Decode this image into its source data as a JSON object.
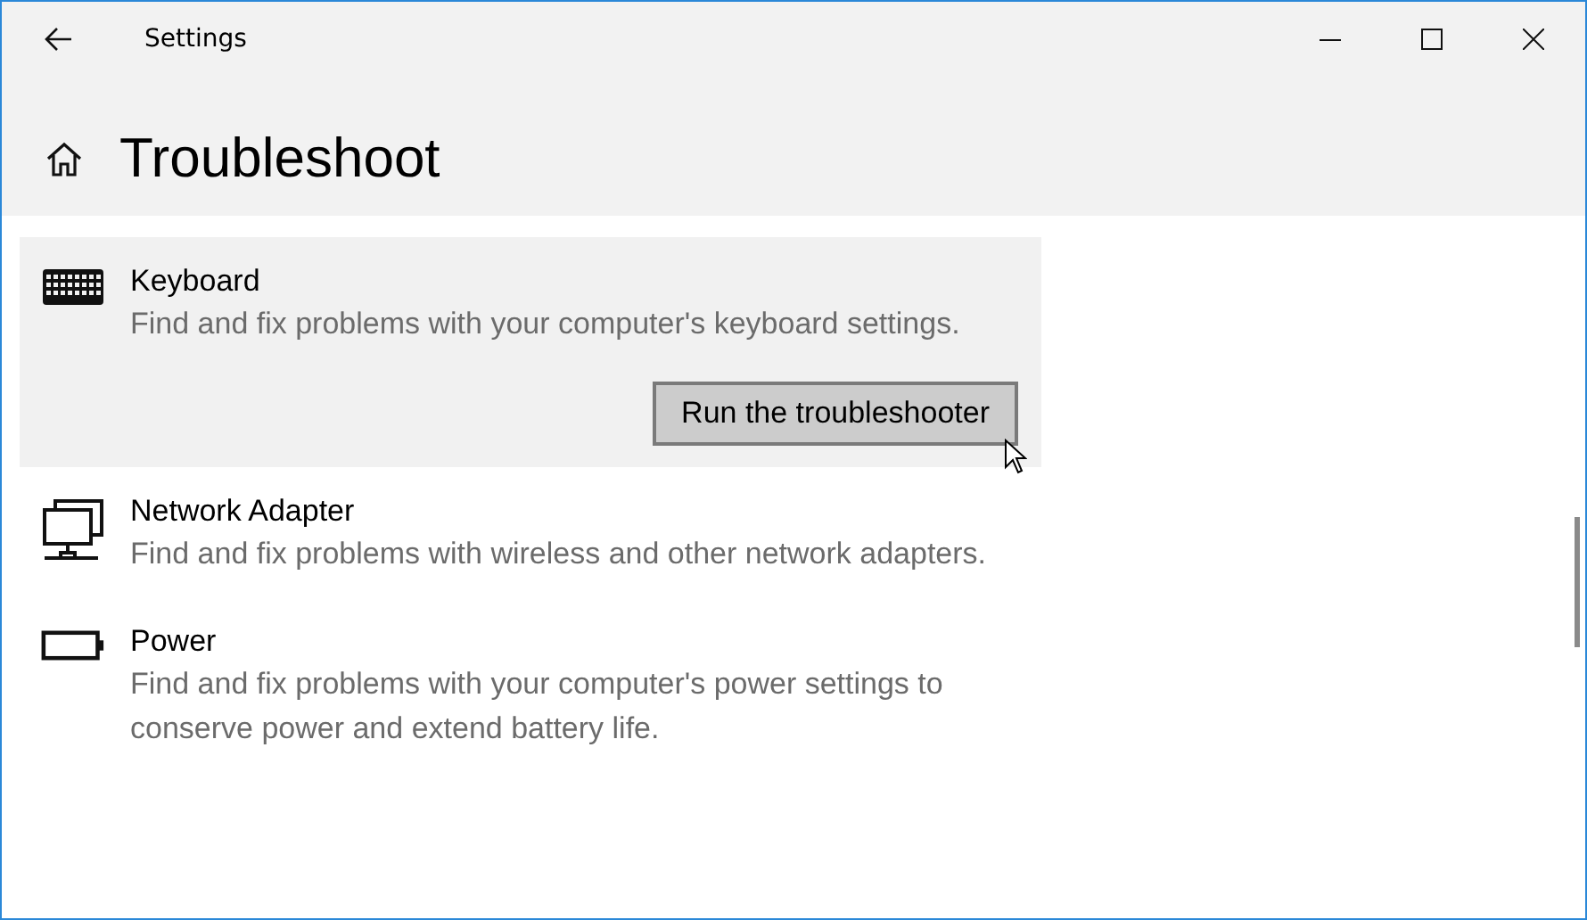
{
  "window": {
    "title": "Settings"
  },
  "page": {
    "title": "Troubleshoot"
  },
  "items": [
    {
      "kind": "keyboard",
      "title": "Keyboard",
      "description": "Find and fix problems with your computer's keyboard settings.",
      "expanded": true,
      "button": "Run the troubleshooter"
    },
    {
      "kind": "network",
      "title": "Network Adapter",
      "description": "Find and fix problems with wireless and other network adapters.",
      "expanded": false
    },
    {
      "kind": "power",
      "title": "Power",
      "description": "Find and fix problems with your computer's power settings to conserve power and extend battery life.",
      "expanded": false
    }
  ]
}
